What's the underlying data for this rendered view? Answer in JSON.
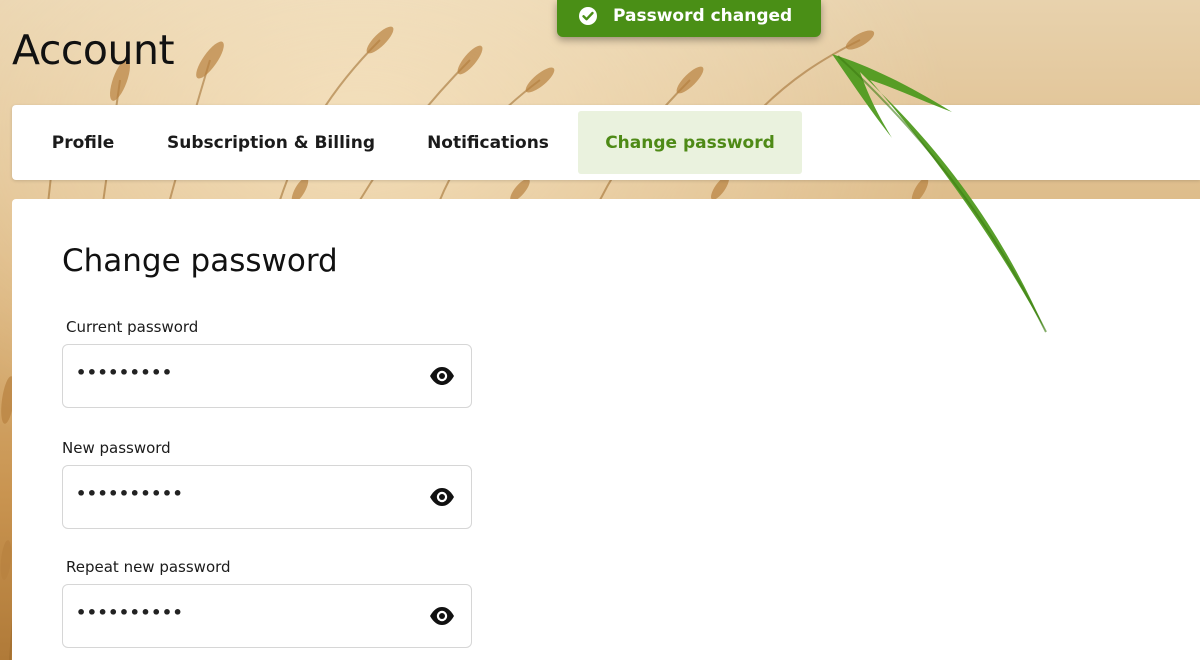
{
  "page": {
    "title": "Account"
  },
  "tabs": [
    {
      "label": "Profile",
      "active": false
    },
    {
      "label": "Subscription & Billing",
      "active": false
    },
    {
      "label": "Notifications",
      "active": false
    },
    {
      "label": "Change password",
      "active": true
    }
  ],
  "form": {
    "title": "Change password",
    "fields": [
      {
        "label": "Current password",
        "value": "•••••••••",
        "icon": "eye-icon"
      },
      {
        "label": "New password",
        "value": "••••••••••",
        "icon": "eye-icon"
      },
      {
        "label": "Repeat new password",
        "value": "••••••••••",
        "icon": "eye-icon"
      }
    ]
  },
  "toast": {
    "message": "Password changed",
    "icon": "check-circle-icon",
    "color": "#4a8f16"
  },
  "colors": {
    "accent": "#4e8a16",
    "active_tab_bg": "#eaf2de",
    "annotation_arrow": "#4f9a1f"
  }
}
